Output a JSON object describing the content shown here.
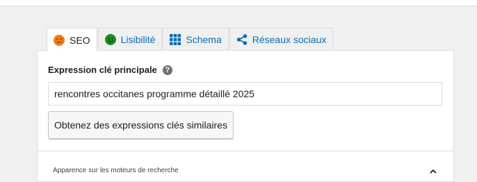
{
  "tabs": [
    {
      "label": "SEO",
      "icon": "orange-face-icon",
      "active": true
    },
    {
      "label": "Lisibilité",
      "icon": "green-smiley-icon",
      "active": false
    },
    {
      "label": "Schema",
      "icon": "grid-icon",
      "active": false
    },
    {
      "label": "Réseaux sociaux",
      "icon": "share-icon",
      "active": false
    }
  ],
  "focus_keyphrase": {
    "label": "Expression clé principale",
    "help_icon": "question-mark-icon",
    "value": "rencontres occitanes programme détaillé 2025"
  },
  "related_button": {
    "label": "Obtenez des expressions clés similaires"
  },
  "search_appearance": {
    "label": "Apparence sur les moteurs de recherche",
    "icon": "chevron-up-icon"
  },
  "colors": {
    "accent_link": "#0a6cab",
    "score_orange": "#ee7c1b",
    "score_green": "#1e8c22",
    "border": "#dcdcde"
  }
}
